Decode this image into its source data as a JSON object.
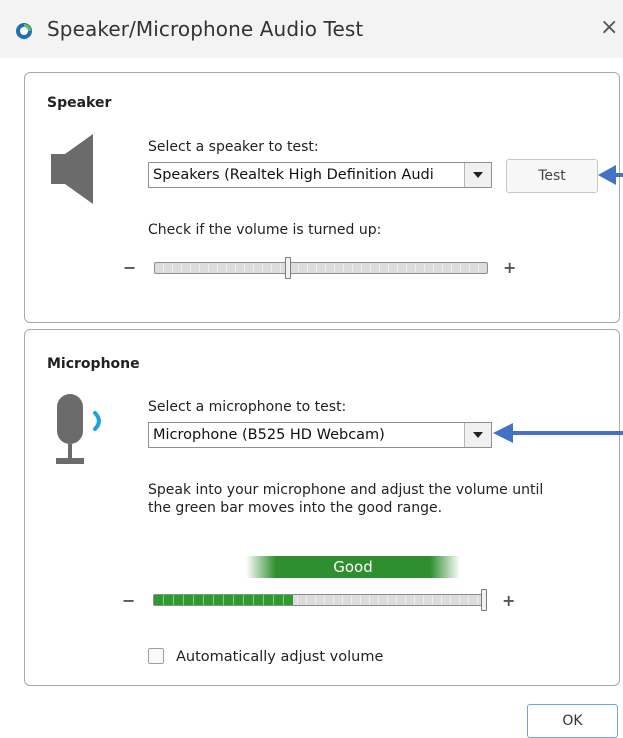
{
  "window": {
    "title": "Speaker/Microphone Audio Test",
    "close_symbol": "×"
  },
  "speaker": {
    "heading": "Speaker",
    "select_label": "Select a speaker to test:",
    "selected_device": "Speakers (Realtek High Definition Audi",
    "test_button": "Test",
    "volume_label": "Check if the volume is turned up:",
    "volume_level": 0.4,
    "icon": "speaker-icon"
  },
  "microphone": {
    "heading": "Microphone",
    "select_label": "Select a microphone to test:",
    "selected_device": "Microphone (B525 HD Webcam)",
    "instructions_line1": "Speak into your microphone and adjust the volume until",
    "instructions_line2": "the green bar moves into the good range.",
    "good_label": "Good",
    "input_level": 0.42,
    "volume_level": 1.0,
    "auto_adjust_label": "Automatically adjust volume",
    "auto_adjust_checked": false,
    "icon": "microphone-icon"
  },
  "slider_signs": {
    "minus": "−",
    "plus": "+"
  },
  "footer": {
    "ok_button": "OK"
  },
  "colors": {
    "good_green": "#2f8e2f",
    "annotation_arrow": "#4472c4",
    "mic_wave": "#1aa3e8"
  }
}
